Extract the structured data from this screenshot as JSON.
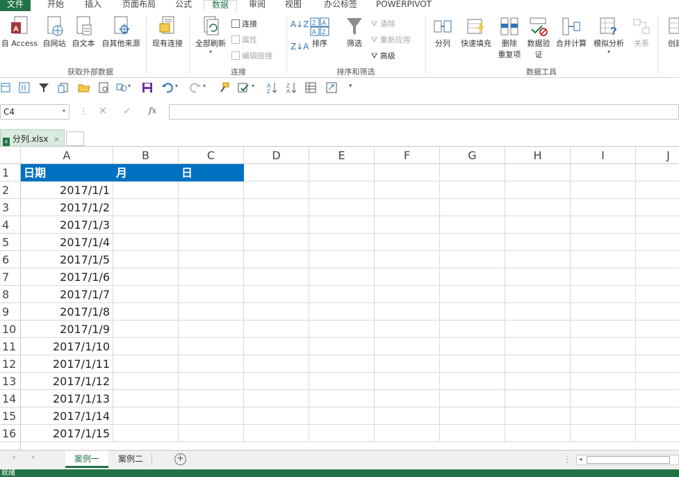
{
  "ribbon_tabs": [
    "文件",
    "开始",
    "插入",
    "页面布局",
    "公式",
    "数据",
    "审阅",
    "视图",
    "办公标签",
    "POWERPIVOT"
  ],
  "active_tab": "数据",
  "groups": {
    "external": {
      "label": "获取外部数据",
      "access": "自 Access",
      "web": "自网站",
      "text": "自文本",
      "other": "自其他来源",
      "existing": "现有连接"
    },
    "connections": {
      "label": "连接",
      "refresh_all": "全部刷新",
      "connections": "连接",
      "properties": "属性",
      "edit_links": "编辑链接"
    },
    "sort_filter": {
      "label": "排序和筛选",
      "sort": "排序",
      "filter": "筛选",
      "clear": "清除",
      "reapply": "重新应用",
      "advanced": "高级"
    },
    "data_tools": {
      "label": "数据工具",
      "text_to_columns": "分列",
      "flash_fill": "快速填充",
      "remove_dup_1": "删除",
      "remove_dup_2": "重复项",
      "validation_1": "数据验",
      "validation_2": "证",
      "consolidate": "合并计算",
      "what_if": "模拟分析",
      "relationships": "关系"
    },
    "outline": {
      "create": "创建"
    }
  },
  "formula_bar": {
    "name_box": "C4",
    "fx": "fx",
    "formula": ""
  },
  "document": {
    "tab_name": "分列.xlsx"
  },
  "columns": [
    "A",
    "B",
    "C",
    "D",
    "E",
    "F",
    "G",
    "H",
    "I",
    "J"
  ],
  "header_row": [
    "日期",
    "月",
    "日"
  ],
  "rows": [
    "2017/1/1",
    "2017/1/2",
    "2017/1/3",
    "2017/1/4",
    "2017/1/5",
    "2017/1/6",
    "2017/1/7",
    "2017/1/8",
    "2017/1/9",
    "2017/1/10",
    "2017/1/11",
    "2017/1/12",
    "2017/1/13",
    "2017/1/14",
    "2017/1/15"
  ],
  "row_numbers": [
    "1",
    "2",
    "3",
    "4",
    "5",
    "6",
    "7",
    "8",
    "9",
    "10",
    "11",
    "12",
    "13",
    "14",
    "15",
    "16"
  ],
  "sheets": [
    "案例一",
    "案例二"
  ],
  "active_sheet": "案例一",
  "status": "就绪",
  "colors": {
    "accent": "#217346",
    "header_fill": "#0070c0"
  }
}
